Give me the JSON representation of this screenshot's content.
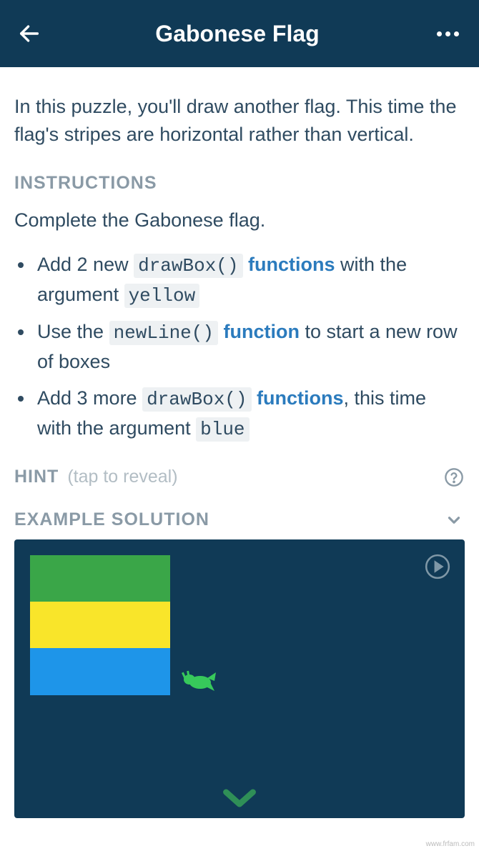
{
  "header": {
    "title": "Gabonese Flag"
  },
  "intro": "In this puzzle, you'll draw another flag. This time the flag's stripes are horizontal rather than vertical.",
  "instructions": {
    "heading": "INSTRUCTIONS",
    "task": "Complete the Gabonese flag.",
    "steps": [
      {
        "pre": "Add 2 new ",
        "code": "drawBox()",
        "kw": " functions",
        "post": " with the argument ",
        "code2": "yellow"
      },
      {
        "pre": "Use the ",
        "code": "newLine()",
        "kw": " function",
        "post": " to start a new row of boxes",
        "code2": ""
      },
      {
        "pre": "Add 3 more ",
        "code": "drawBox()",
        "kw": " functions",
        "post": ", this time with the argument ",
        "code2": "blue"
      }
    ]
  },
  "hint": {
    "label": "HINT",
    "reveal": "(tap to reveal)"
  },
  "example": {
    "label": "EXAMPLE SOLUTION",
    "flag_colors": [
      "green",
      "yellow",
      "blue"
    ]
  },
  "watermark": "www.frfam.com"
}
